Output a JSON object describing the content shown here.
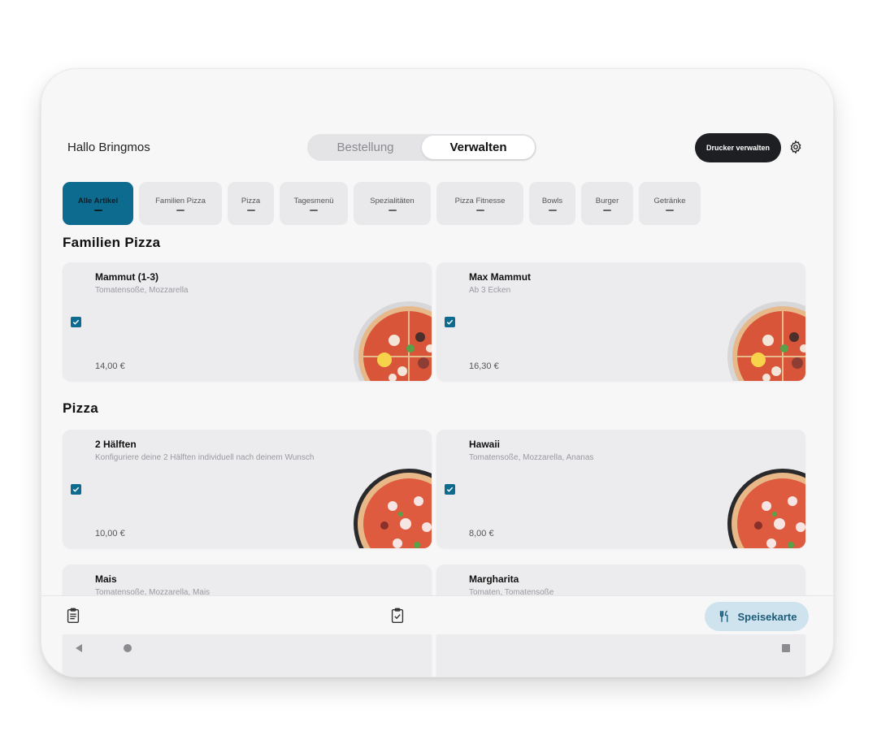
{
  "header": {
    "greeting": "Hallo Bringmos",
    "tabs": [
      {
        "label": "Bestellung",
        "active": false
      },
      {
        "label": "Verwalten",
        "active": true
      }
    ],
    "printer_button": "Drucker verwalten",
    "settings_icon": "gear-icon"
  },
  "categories": [
    {
      "label": "Alle Artikel",
      "active": true
    },
    {
      "label": "Familien Pizza",
      "active": false
    },
    {
      "label": "Pizza",
      "active": false
    },
    {
      "label": "Tagesmenü",
      "active": false
    },
    {
      "label": "Spezialitäten",
      "active": false
    },
    {
      "label": "Pizza Fitnesse",
      "active": false
    },
    {
      "label": "Bowls",
      "active": false
    },
    {
      "label": "Burger",
      "active": false
    },
    {
      "label": "Getränke",
      "active": false
    }
  ],
  "sections": [
    {
      "title": "Familien Pizza",
      "items": [
        {
          "name": "Mammut (1-3)",
          "desc": "Tomatensoße, Mozzarella",
          "price": "14,00 €",
          "checked": true
        },
        {
          "name": "Max Mammut",
          "desc": "Ab 3 Ecken",
          "price": "16,30 €",
          "checked": true
        }
      ]
    },
    {
      "title": "Pizza",
      "items": [
        {
          "name": "2 Hälften",
          "desc": "Konfiguriere deine 2 Hälften individuell nach deinem Wunsch",
          "price": "10,00 €",
          "checked": true
        },
        {
          "name": "Hawaii",
          "desc": "Tomatensoße, Mozzarella, Ananas",
          "price": "8,00 €",
          "checked": true
        },
        {
          "name": "Mais",
          "desc": "Tomatensoße, Mozzarella, Mais",
          "price": "",
          "checked": true
        },
        {
          "name": "Margharita",
          "desc": "Tomaten, Tomatensoße",
          "price": "",
          "checked": true
        }
      ]
    }
  ],
  "bottom_bar": {
    "left_icon": "clipboard-list-icon",
    "center_icon": "clipboard-check-icon",
    "menu_button": "Speisekarte",
    "menu_icon": "fork-knife-icon"
  },
  "system_nav": {
    "back": "back-triangle-icon",
    "home": "home-circle-icon",
    "recent": "recent-square-icon"
  },
  "colors": {
    "accent": "#0c6b8f",
    "dark_button": "#1d1f22",
    "menu_button_bg": "#cfe3ee",
    "card_bg": "#ececee"
  }
}
